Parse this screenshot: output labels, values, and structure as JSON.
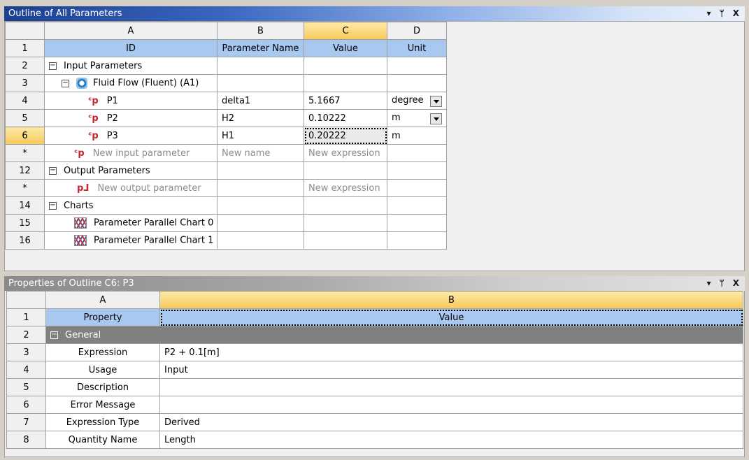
{
  "outline": {
    "title": "Outline of All Parameters",
    "controls": [
      "▾",
      "ᛘ",
      "X"
    ],
    "columns": [
      "A",
      "B",
      "C",
      "D"
    ],
    "header": {
      "id": "ID",
      "name": "Parameter Name",
      "value": "Value",
      "unit": "Unit"
    },
    "rows": [
      {
        "num": "1"
      },
      {
        "num": "2",
        "label": "Input Parameters"
      },
      {
        "num": "3",
        "label": "Fluid Flow (Fluent) (A1)"
      },
      {
        "num": "4",
        "label": "P1",
        "name": "delta1",
        "value": "5.1667",
        "unit": "degree"
      },
      {
        "num": "5",
        "label": "P2",
        "name": "H2",
        "value": "0.10222",
        "unit": "m"
      },
      {
        "num": "6",
        "label": "P3",
        "name": "H1",
        "value": "0.20222",
        "unit": "m"
      },
      {
        "num": "*",
        "label": "New input parameter",
        "name": "New name",
        "value": "New expression"
      },
      {
        "num": "12",
        "label": "Output Parameters"
      },
      {
        "num": "*",
        "label": "New output parameter",
        "value": "New expression"
      },
      {
        "num": "14",
        "label": "Charts"
      },
      {
        "num": "15",
        "label": "Parameter Parallel Chart 0"
      },
      {
        "num": "16",
        "label": "Parameter Parallel Chart 1"
      }
    ]
  },
  "properties": {
    "title": "Properties of Outline C6: P3",
    "controls": [
      "▾",
      "ᛘ",
      "X"
    ],
    "columns": [
      "A",
      "B"
    ],
    "header": {
      "property": "Property",
      "value": "Value"
    },
    "section": "General",
    "rows": [
      {
        "num": "1"
      },
      {
        "num": "2"
      },
      {
        "num": "3",
        "property": "Expression",
        "value": "P2 + 0.1[m]"
      },
      {
        "num": "4",
        "property": "Usage",
        "value": "Input"
      },
      {
        "num": "5",
        "property": "Description",
        "value": ""
      },
      {
        "num": "6",
        "property": "Error Message",
        "value": ""
      },
      {
        "num": "7",
        "property": "Expression Type",
        "value": "Derived"
      },
      {
        "num": "8",
        "property": "Quantity Name",
        "value": "Length"
      }
    ]
  }
}
